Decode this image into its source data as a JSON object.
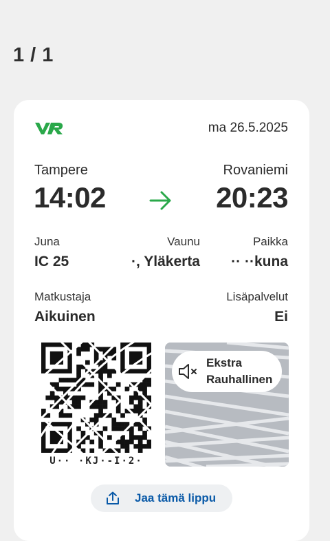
{
  "pager": "1 / 1",
  "ticket": {
    "date": "ma 26.5.2025",
    "from": {
      "city": "Tampere",
      "time": "14:02"
    },
    "to": {
      "city": "Rovaniemi",
      "time": "20:23"
    },
    "train_label": "Juna",
    "train_value": "IC 25",
    "car_label": "Vaunu",
    "car_value": "·, Yläkerta",
    "seat_label": "Paikka",
    "seat_value": "·· ··kuna",
    "passenger_label": "Matkustaja",
    "passenger_value": "Aikuinen",
    "extras_label": "Lisäpalvelut",
    "extras_value": "Ei",
    "qr_code_text": "U·· ·KJ·-I·2·",
    "cabin_line1": "Ekstra",
    "cabin_line2": "Rauhallinen"
  },
  "share_button": {
    "label": "Jaa tämä lippu",
    "icon": "share-icon"
  },
  "colors": {
    "brand_green": "#2aa84a",
    "link_blue": "#0a5aa8",
    "card_bg": "#ffffff",
    "page_bg": "#f0f0f0"
  }
}
